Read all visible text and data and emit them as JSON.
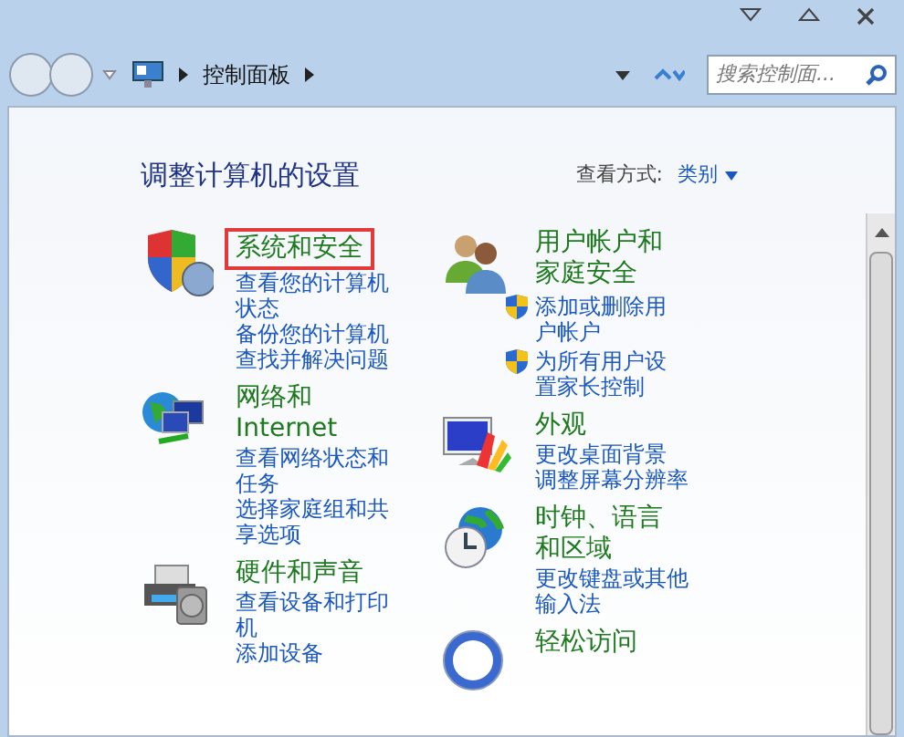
{
  "address_bar": {
    "path": [
      "控制面板"
    ],
    "search": {
      "placeholder": "搜索控制面..."
    }
  },
  "header": {
    "title": "调整计算机的设置",
    "view_label": "查看方式:",
    "view_value": "类别"
  },
  "columns": [
    {
      "categories": [
        {
          "title": "系统和安全",
          "highlighted": true,
          "links": [
            {
              "text": "查看您的计算机状态",
              "shield": false
            },
            {
              "text": "备份您的计算机",
              "shield": false
            },
            {
              "text": "查找并解决问题",
              "shield": false
            }
          ]
        },
        {
          "title": "网络和 Internet",
          "highlighted": false,
          "links": [
            {
              "text": "查看网络状态和任务",
              "shield": false
            },
            {
              "text": "选择家庭组和共享选项",
              "shield": false
            }
          ]
        },
        {
          "title": "硬件和声音",
          "highlighted": false,
          "links": [
            {
              "text": "查看设备和打印机",
              "shield": false
            },
            {
              "text": "添加设备",
              "shield": false
            }
          ]
        }
      ]
    },
    {
      "categories": [
        {
          "title": "用户帐户和家庭安全",
          "highlighted": false,
          "links": [
            {
              "text": "添加或删除用户帐户",
              "shield": true
            },
            {
              "text": "为所有用户设置家长控制",
              "shield": true
            }
          ]
        },
        {
          "title": "外观",
          "highlighted": false,
          "links": [
            {
              "text": "更改桌面背景",
              "shield": false
            },
            {
              "text": "调整屏幕分辨率",
              "shield": false
            }
          ]
        },
        {
          "title": "时钟、语言和区域",
          "highlighted": false,
          "links": [
            {
              "text": "更改键盘或其他输入法",
              "shield": false
            }
          ]
        },
        {
          "title": "轻松访问",
          "highlighted": false
        }
      ]
    }
  ]
}
